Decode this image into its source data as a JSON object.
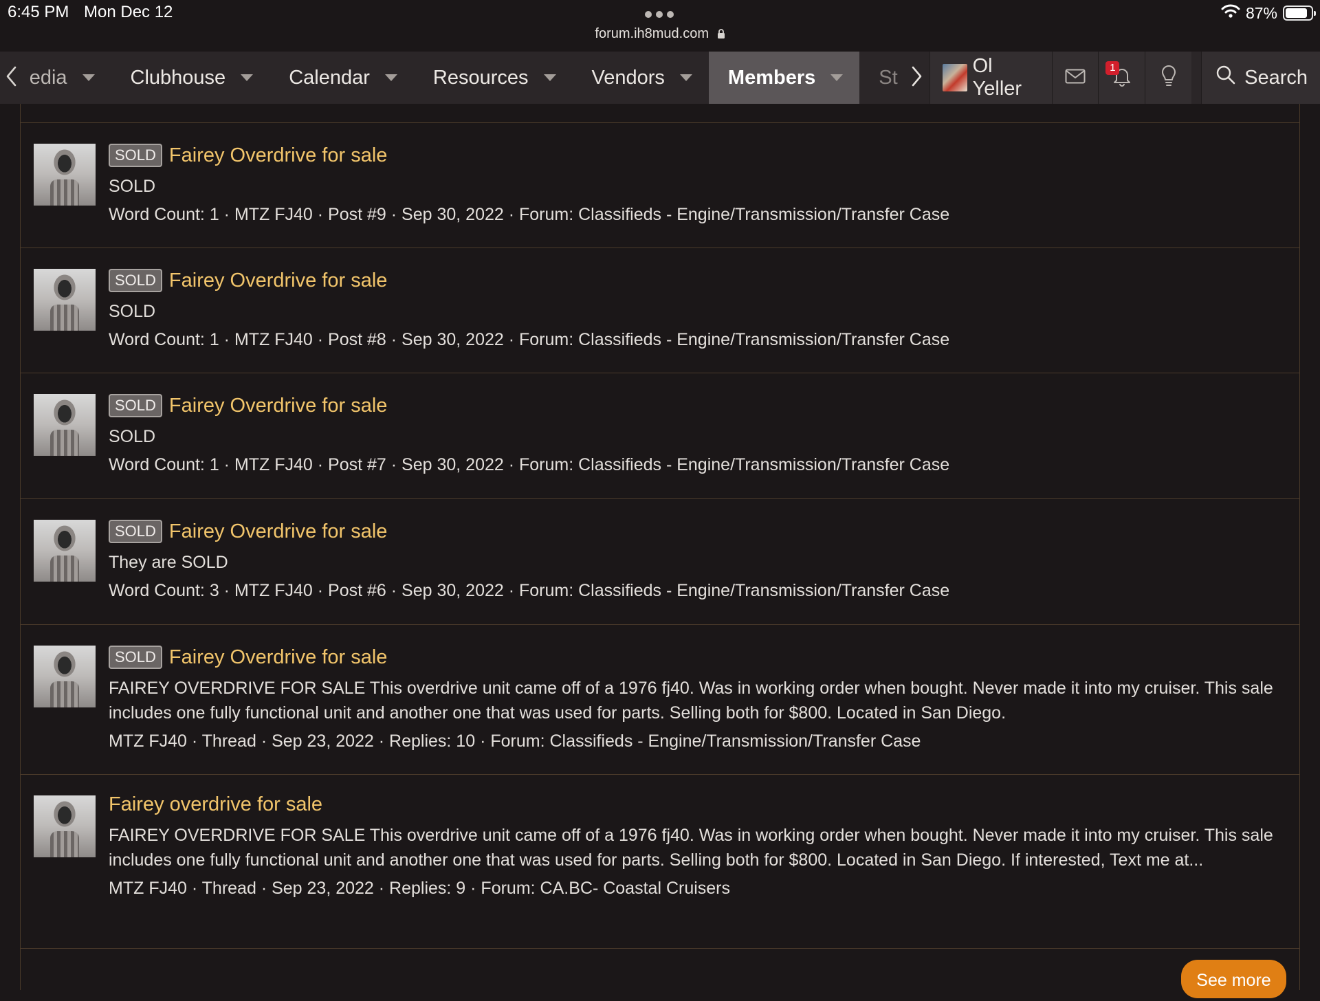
{
  "status_bar": {
    "time": "6:45 PM",
    "date": "Mon Dec 12",
    "url": "forum.ih8mud.com",
    "battery": "87%",
    "battery_level": 0.87
  },
  "nav": {
    "tabs": [
      {
        "label": "edia",
        "caret": true
      },
      {
        "label": "Clubhouse",
        "caret": true
      },
      {
        "label": "Calendar",
        "caret": true
      },
      {
        "label": "Resources",
        "caret": true
      },
      {
        "label": "Vendors",
        "caret": true
      },
      {
        "label": "Members",
        "caret": true,
        "active": true
      },
      {
        "label": "St",
        "caret": false
      }
    ],
    "user": "Ol Yeller",
    "alerts_count": "1",
    "search_label": "Search",
    "icons": {
      "back": "chevron-left-icon",
      "forward": "chevron-right-icon",
      "inbox": "envelope-icon",
      "alerts": "bell-icon",
      "whats_new": "lightbulb-icon",
      "search": "search-icon"
    }
  },
  "results": [
    {
      "tag": "SOLD",
      "title": "Fairey Overdrive for sale",
      "snippet": "SOLD",
      "meta": "Word Count: 1 · MTZ FJ40 · Post #9 · Sep 30, 2022 · Forum: Classifieds - Engine/Transmission/Transfer Case"
    },
    {
      "tag": "SOLD",
      "title": "Fairey Overdrive for sale",
      "snippet": "SOLD",
      "meta": "Word Count: 1 · MTZ FJ40 · Post #8 · Sep 30, 2022 · Forum: Classifieds - Engine/Transmission/Transfer Case"
    },
    {
      "tag": "SOLD",
      "title": "Fairey Overdrive for sale",
      "snippet": "SOLD",
      "meta": "Word Count: 1 · MTZ FJ40 · Post #7 · Sep 30, 2022 · Forum: Classifieds - Engine/Transmission/Transfer Case"
    },
    {
      "tag": "SOLD",
      "title": "Fairey Overdrive for sale",
      "snippet": "They are SOLD",
      "meta": "Word Count: 3 · MTZ FJ40 · Post #6 · Sep 30, 2022 · Forum: Classifieds - Engine/Transmission/Transfer Case"
    },
    {
      "tag": "SOLD",
      "title": "Fairey Overdrive for sale",
      "snippet": "FAIREY OVERDRIVE FOR SALE This overdrive unit came off of a 1976 fj40. Was in working order when bought. Never made it into my cruiser. This sale includes one fully functional unit and another one that was used for parts. Selling both for $800. Located in San Diego.",
      "meta": "MTZ FJ40 · Thread · Sep 23, 2022 · Replies: 10 · Forum: Classifieds - Engine/Transmission/Transfer Case"
    },
    {
      "tag": "",
      "title": "Fairey overdrive for sale",
      "snippet": "FAIREY OVERDRIVE FOR SALE This overdrive unit came off of a 1976 fj40. Was in working order when bought. Never made it into my cruiser. This sale includes one fully functional unit and another one that was used for parts. Selling both for $800. Located in San Diego. If interested, Text me at...",
      "meta": "MTZ FJ40 · Thread · Sep 23, 2022 · Replies: 9 · Forum: CA.BC- Coastal Cruisers"
    }
  ],
  "see_more": "See more",
  "colors": {
    "background": "#1b1718",
    "nav": "#2b2628",
    "title": "#f2c56b",
    "accent_button": "#e07f14",
    "badge": "#d21f2c"
  }
}
